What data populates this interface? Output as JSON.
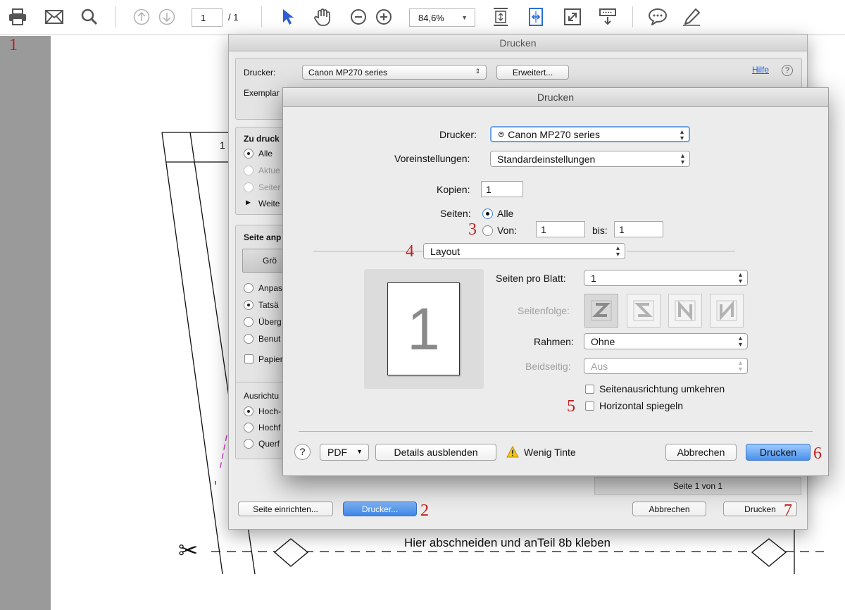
{
  "toolbar": {
    "page_current": "1",
    "page_total": "/ 1",
    "zoom": "84,6%"
  },
  "document": {
    "cut_line_text": "Hier abschneiden und anTeil 8b kleben",
    "partial_label": "1"
  },
  "annotations": [
    "1",
    "2",
    "3",
    "4",
    "5",
    "6",
    "7"
  ],
  "acrobat_dialog": {
    "title": "Drucken",
    "printer_label": "Drucker:",
    "printer_value": "Canon MP270 series",
    "advanced_button": "Erweitert...",
    "help_link": "Hilfe",
    "help_icon": "?",
    "copies_label": "Exemplar",
    "pages_section": {
      "title": "Zu druck",
      "options": [
        {
          "label": "Alle",
          "selected": true,
          "enabled": true
        },
        {
          "label": "Aktue",
          "selected": false,
          "enabled": false
        },
        {
          "label": "Seiter",
          "selected": false,
          "enabled": false
        }
      ],
      "more_label": "Weite"
    },
    "fit_section": {
      "title": "Seite anp",
      "size_button": "Grö",
      "options": [
        {
          "label": "Anpas",
          "selected": false
        },
        {
          "label": "Tatsä",
          "selected": true
        },
        {
          "label": "Überg",
          "selected": false
        },
        {
          "label": "Benut",
          "selected": false
        }
      ],
      "paper_checkbox": "Papier"
    },
    "orientation_section": {
      "title": "Ausrichtu",
      "options": [
        {
          "label": "Hoch-",
          "selected": true
        },
        {
          "label": "Hochf",
          "selected": false
        },
        {
          "label": "Querf",
          "selected": false
        }
      ]
    },
    "page_indicator": "Seite 1 von 1",
    "page_setup_button": "Seite einrichten...",
    "printer_button": "Drucker...",
    "cancel_button": "Abbrechen",
    "print_button": "Drucken"
  },
  "mac_dialog": {
    "title": "Drucken",
    "printer_label": "Drucker:",
    "printer_value": "Canon MP270 series",
    "presets_label": "Voreinstellungen:",
    "presets_value": "Standardeinstellungen",
    "copies_label": "Kopien:",
    "copies_value": "1",
    "pages_label": "Seiten:",
    "pages_all": "Alle",
    "pages_from": "Von:",
    "pages_from_value": "1",
    "pages_to": "bis:",
    "pages_to_value": "1",
    "section_popup": "Layout",
    "preview_page_number": "1",
    "pages_per_sheet_label": "Seiten pro Blatt:",
    "pages_per_sheet_value": "1",
    "page_order_label": "Seitenfolge:",
    "border_label": "Rahmen:",
    "border_value": "Ohne",
    "duplex_label": "Beidseitig:",
    "duplex_value": "Aus",
    "reverse_orientation": "Seitenausrichtung umkehren",
    "flip_horizontal": "Horizontal spiegeln",
    "help_button": "?",
    "pdf_button": "PDF",
    "hide_details_button": "Details ausblenden",
    "warning_text": "Wenig Tinte",
    "cancel_button": "Abbrechen",
    "print_button": "Drucken"
  }
}
